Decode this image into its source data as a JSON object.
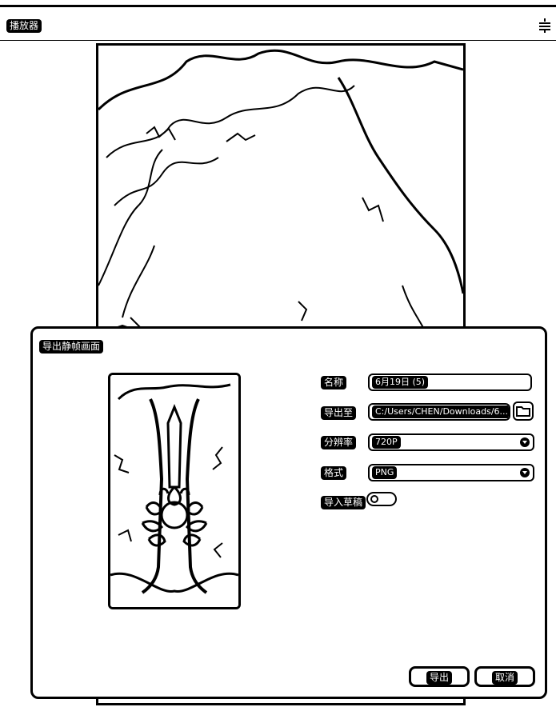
{
  "app": {
    "title": "播放器"
  },
  "dialog": {
    "title": "导出静帧画面",
    "fields": {
      "name": {
        "label": "名称",
        "value": "6月19日 (5)"
      },
      "export_to": {
        "label": "导出至",
        "value": "C:/Users/CHEN/Downloads/6..."
      },
      "resolution": {
        "label": "分辨率",
        "value": "720P"
      },
      "format": {
        "label": "格式",
        "value": "PNG"
      },
      "import_draft": {
        "label": "导入草稿",
        "enabled": false
      }
    },
    "buttons": {
      "export": "导出",
      "cancel": "取消"
    }
  },
  "icons": {
    "menu": "menu-lines-icon",
    "folder": "folder-icon",
    "caret": "chevron-down-icon"
  }
}
